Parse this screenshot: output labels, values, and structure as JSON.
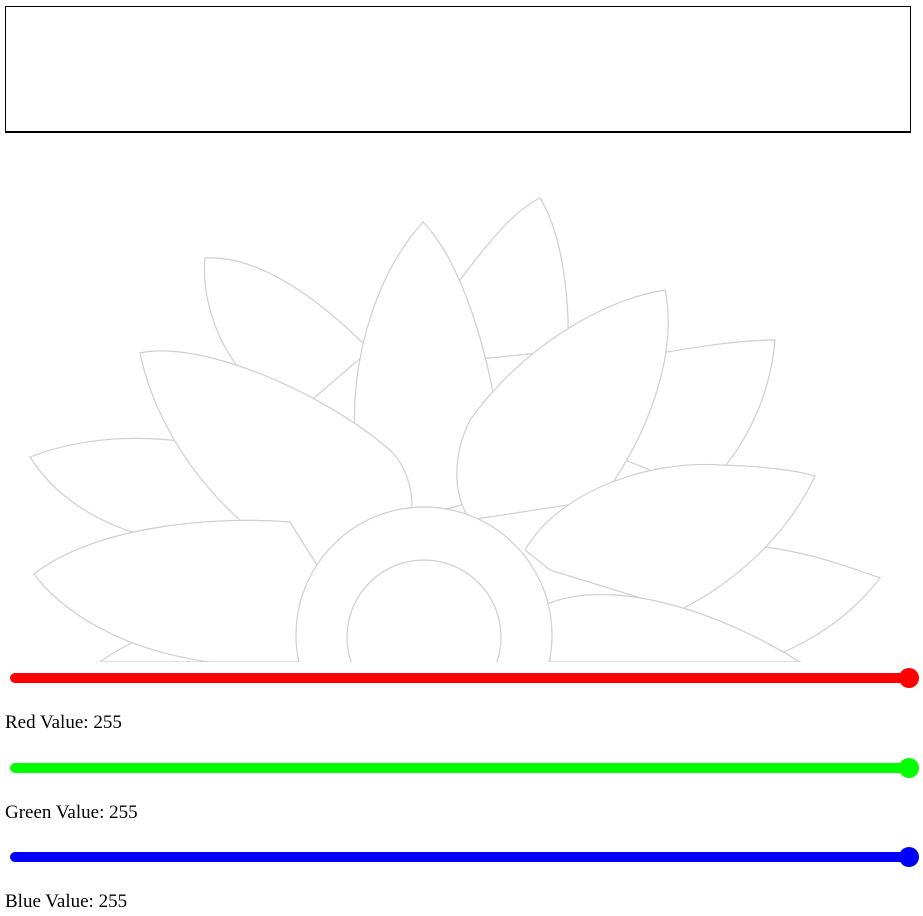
{
  "sliders": [
    {
      "name": "red",
      "label_text": "Red Value: ",
      "value": "255",
      "level": 1.0,
      "color": "#ff0000"
    },
    {
      "name": "green",
      "label_text": "Green Value: ",
      "value": "255",
      "level": 1.0,
      "color": "#00ff00"
    },
    {
      "name": "blue",
      "label_text": "Blue Value: ",
      "value": "255",
      "level": 1.0,
      "color": "#0000ff"
    }
  ],
  "flower": {
    "stroke_color": "#cfcfcf",
    "fill_color": "#ffffff"
  }
}
